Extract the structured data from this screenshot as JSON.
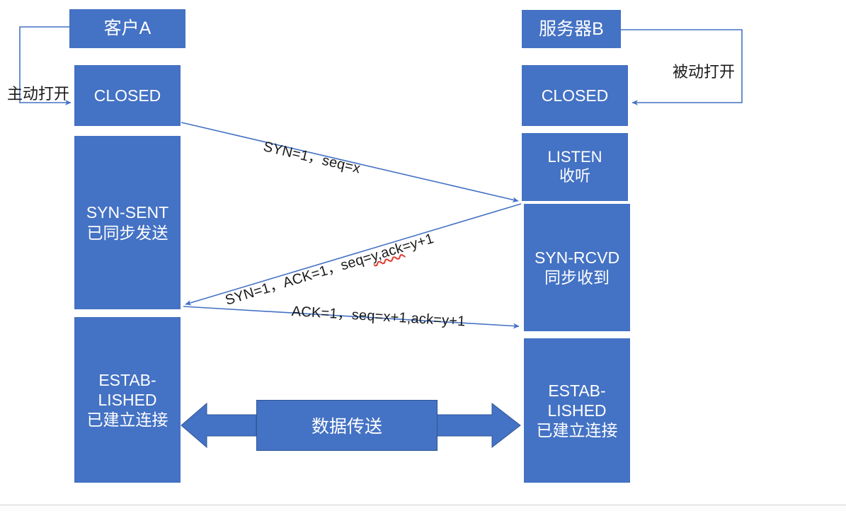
{
  "diagram": {
    "title_nodes": {
      "client": "客户A",
      "server": "服务器B"
    },
    "client_states": [
      {
        "id": "closed",
        "label": "CLOSED"
      },
      {
        "id": "syn-sent",
        "label": "SYN-SENT\n已同步发送"
      },
      {
        "id": "established",
        "label": "ESTAB-\nLISHED\n已建立连接"
      }
    ],
    "server_states": [
      {
        "id": "closed",
        "label": "CLOSED"
      },
      {
        "id": "listen",
        "label": "LISTEN\n收听"
      },
      {
        "id": "syn-rcvd",
        "label": "SYN-RCVD\n同步收到"
      },
      {
        "id": "established",
        "label": "ESTAB-\nLISHED\n已建立连接"
      }
    ],
    "open_labels": {
      "active": "主动打开",
      "passive": "被动打开"
    },
    "messages": [
      {
        "id": "syn",
        "text": "SYN=1，seq=x",
        "direction": "client-to-server"
      },
      {
        "id": "syn-ack",
        "pre": "SYN=1，ACK=1，seq=",
        "misspelled": "y,ack",
        "post": "=y+1",
        "direction": "server-to-client"
      },
      {
        "id": "ack",
        "text": "ACK=1，seq=x+1,ack=y+1",
        "direction": "client-to-server"
      }
    ],
    "data_transfer": {
      "label": "数据传送"
    },
    "colors": {
      "box_fill": "#4472C4",
      "box_text": "#ffffff",
      "connector": "#4472C4",
      "arrow_line": "#4472C4",
      "block_arrow": "#4472C4",
      "block_arrow_stroke": "#2f5597",
      "spellcheck_underline": "#e03a2f",
      "page_background": "#ffffff",
      "separator": "#d0d0d0"
    }
  }
}
